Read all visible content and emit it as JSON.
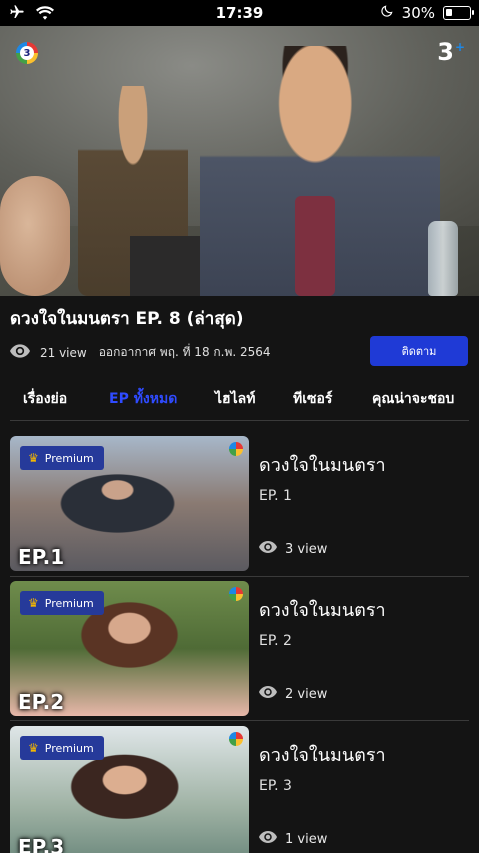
{
  "status_bar": {
    "time": "17:39",
    "battery_text": "30%",
    "battery_level": 0.3,
    "icons": [
      "airplane-icon",
      "wifi-icon",
      "moon-icon",
      "battery-icon"
    ]
  },
  "hero": {
    "channel_logo": "3",
    "brand_logo": "3",
    "brand_logo_plus": "+"
  },
  "show": {
    "title": "ดวงใจในมนตรา  EP. 8 (ล่าสุด)",
    "views": "21 view",
    "air_date": "ออกอากาศ พฤ. ที่ 18 ก.พ. 2564",
    "follow_label": "ติดตาม"
  },
  "tabs": [
    {
      "label": "เรื่องย่อ",
      "active": false
    },
    {
      "label": "EP ทั้งหมด",
      "active": true
    },
    {
      "label": "ไฮไลท์",
      "active": false
    },
    {
      "label": "ทีเซอร์",
      "active": false
    },
    {
      "label": "คุณน่าจะชอบ",
      "active": false
    }
  ],
  "episodes": [
    {
      "badge": "Premium",
      "thumb_label": "EP.1",
      "name": "ดวงใจในมนตรา",
      "ep": "EP. 1",
      "views": "3 view"
    },
    {
      "badge": "Premium",
      "thumb_label": "EP.2",
      "name": "ดวงใจในมนตรา",
      "ep": "EP. 2",
      "views": "2 view"
    },
    {
      "badge": "Premium",
      "thumb_label": "EP.3",
      "name": "ดวงใจในมนตรา",
      "ep": "EP. 3",
      "views": "1 view"
    }
  ],
  "colors": {
    "accent": "#1f3ad6",
    "active_tab": "#2f4bff",
    "premium_badge": "#263a9a",
    "background": "#141414"
  }
}
